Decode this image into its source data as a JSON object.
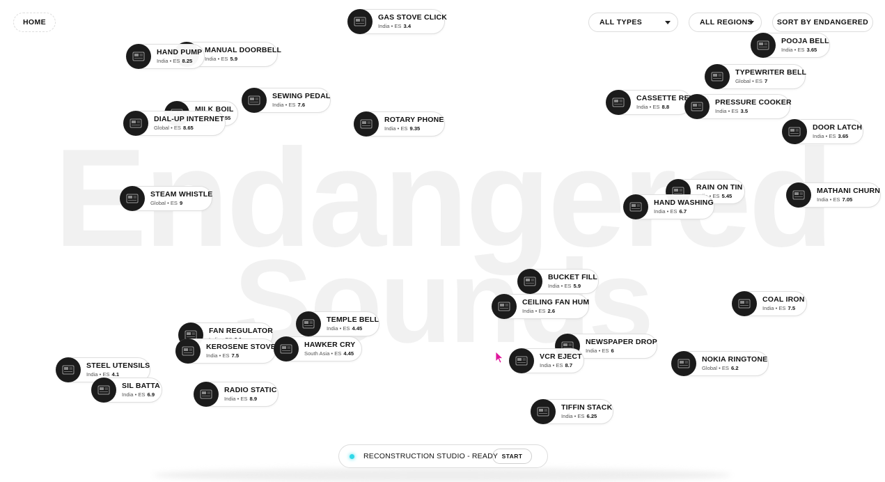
{
  "background_title": {
    "line1": "Endangered",
    "line2": "Sounds"
  },
  "nav": {
    "home_label": "HOME",
    "types_label": "ALL TYPES",
    "regions_label": "ALL REGIONS",
    "sort_label": "SORT BY ENDANGERED"
  },
  "sounds": [
    {
      "name": "GAS STOVE CLICK",
      "region": "India",
      "tag": "ES",
      "score": "3.4"
    },
    {
      "name": "MANUAL DOORBELL",
      "region": "India",
      "tag": "ES",
      "score": "5.9"
    },
    {
      "name": "HAND PUMP",
      "region": "India",
      "tag": "ES",
      "score": "8.25"
    },
    {
      "name": "POOJA BELL",
      "region": "India",
      "tag": "ES",
      "score": "3.65"
    },
    {
      "name": "TYPEWRITER BELL",
      "region": "Global",
      "tag": "ES",
      "score": "7"
    },
    {
      "name": "SEWING PEDAL",
      "region": "India",
      "tag": "ES",
      "score": "7.6"
    },
    {
      "name": "MILK BOIL",
      "region": "India",
      "tag": "ES",
      "score": "5.55"
    },
    {
      "name": "DIAL-UP INTERNET",
      "region": "Global",
      "tag": "ES",
      "score": "8.65"
    },
    {
      "name": "ROTARY PHONE",
      "region": "India",
      "tag": "ES",
      "score": "9.35"
    },
    {
      "name": "CASSETTE REWIND",
      "region": "India",
      "tag": "ES",
      "score": "8.8"
    },
    {
      "name": "PRESSURE COOKER",
      "region": "India",
      "tag": "ES",
      "score": "3.5"
    },
    {
      "name": "DOOR LATCH",
      "region": "India",
      "tag": "ES",
      "score": "3.65"
    },
    {
      "name": "STEAM WHISTLE",
      "region": "Global",
      "tag": "ES",
      "score": "9"
    },
    {
      "name": "RAIN ON TIN",
      "region": "India",
      "tag": "ES",
      "score": "5.45"
    },
    {
      "name": "HAND WASHING",
      "region": "India",
      "tag": "ES",
      "score": "6.7"
    },
    {
      "name": "MATHANI CHURN",
      "region": "India",
      "tag": "ES",
      "score": "7.05"
    },
    {
      "name": "BUCKET FILL",
      "region": "India",
      "tag": "ES",
      "score": "5.9"
    },
    {
      "name": "CEILING FAN HUM",
      "region": "India",
      "tag": "ES",
      "score": "2.6"
    },
    {
      "name": "COAL IRON",
      "region": "India",
      "tag": "ES",
      "score": "7.5"
    },
    {
      "name": "TEMPLE BELL",
      "region": "India",
      "tag": "ES",
      "score": "4.45"
    },
    {
      "name": "FAN REGULATOR",
      "region": "India",
      "tag": "ES",
      "score": "6.1"
    },
    {
      "name": "KEROSENE STOVE",
      "region": "India",
      "tag": "ES",
      "score": "7.5"
    },
    {
      "name": "HAWKER CRY",
      "region": "South Asia",
      "tag": "ES",
      "score": "4.45"
    },
    {
      "name": "NEWSPAPER DROP",
      "region": "India",
      "tag": "ES",
      "score": "6"
    },
    {
      "name": "VCR EJECT",
      "region": "India",
      "tag": "ES",
      "score": "8.7"
    },
    {
      "name": "NOKIA RINGTONE",
      "region": "Global",
      "tag": "ES",
      "score": "6.2"
    },
    {
      "name": "STEEL UTENSILS",
      "region": "India",
      "tag": "ES",
      "score": "4.1"
    },
    {
      "name": "SIL BATTA",
      "region": "India",
      "tag": "ES",
      "score": "6.9"
    },
    {
      "name": "RADIO STATIC",
      "region": "India",
      "tag": "ES",
      "score": "8.9"
    },
    {
      "name": "TIFFIN STACK",
      "region": "India",
      "tag": "ES",
      "score": "6.25"
    }
  ],
  "studio": {
    "status_label": "RECONSTRUCTION STUDIO - READY",
    "start_label": "START",
    "status_color": "#2fd8e8"
  },
  "cursor": {
    "color": "#e0169c"
  }
}
